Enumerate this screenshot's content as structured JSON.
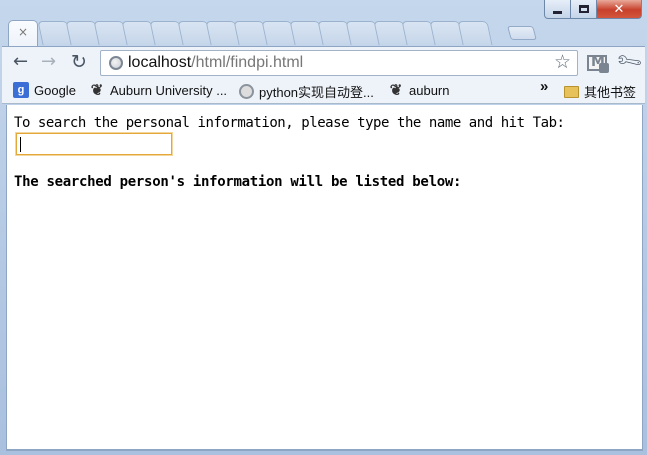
{
  "window": {
    "tab_close_glyph": "×",
    "controls": {
      "minimize": "minimize",
      "maximize": "maximize",
      "close_glyph": "✕"
    }
  },
  "toolbar": {
    "url_host": "localhost",
    "url_path": "/html/findpi.html",
    "icons": [
      "back-arrow-icon",
      "forward-arrow-icon",
      "reload-icon",
      "globe-icon",
      "star-icon",
      "gmail-icon",
      "wrench-icon"
    ]
  },
  "bookmarks": {
    "items": [
      {
        "label": "Google",
        "icon": "google-icon"
      },
      {
        "label": "Auburn University ...",
        "icon": "paw-icon"
      },
      {
        "label": "python实现自动登...",
        "icon": "globe-icon"
      },
      {
        "label": "auburn",
        "icon": "paw-icon"
      }
    ],
    "overflow": "»",
    "other_folder": "其他书签"
  },
  "page": {
    "prompt": "To search the personal information, please type the name and hit Tab:",
    "input_value": "",
    "result_heading": "The searched person's information will be listed below:"
  },
  "colors": {
    "frame": "#b3c8e3",
    "toolbar": "#eef3fa",
    "input_focus_border": "#e4a73a",
    "close_button": "#c7402b"
  }
}
